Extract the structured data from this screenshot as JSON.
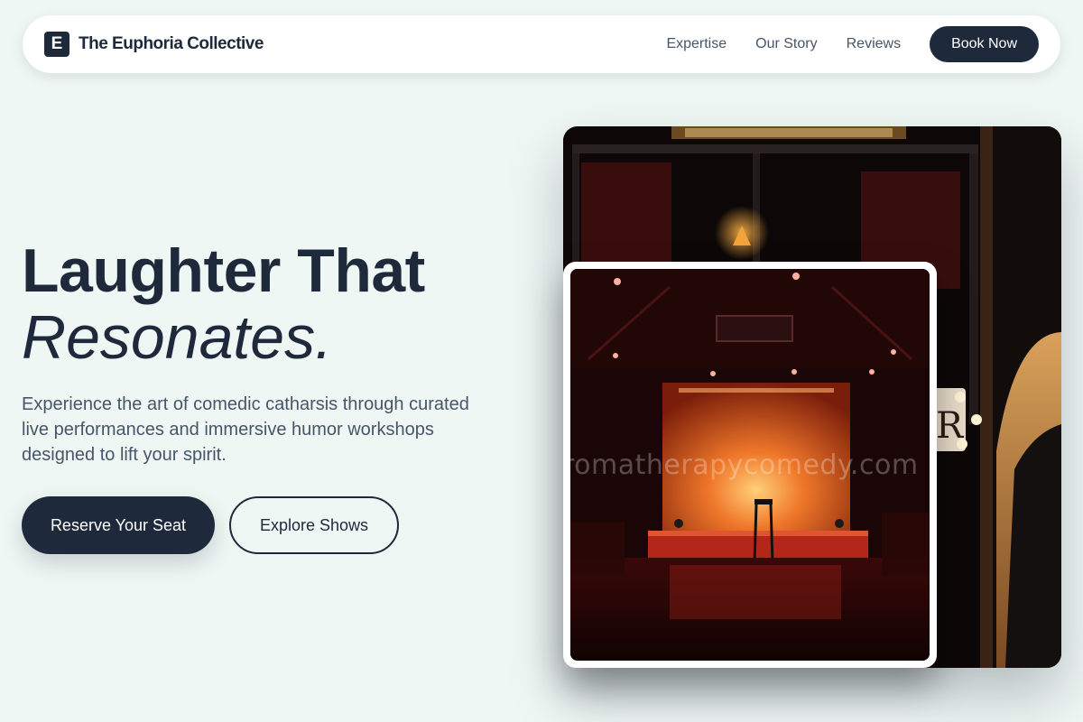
{
  "nav": {
    "logo_letter": "E",
    "brand": "The Euphoria Collective",
    "links": [
      "Expertise",
      "Our Story",
      "Reviews"
    ],
    "cta": "Book Now"
  },
  "hero": {
    "title_line1": "Laughter That",
    "title_line2": "Resonates.",
    "subtitle": "Experience the art of comedic catharsis through curated live performances and immersive humor workshops designed to lift your spirit.",
    "primary_cta": "Reserve Your Seat",
    "secondary_cta": "Explore Shows"
  },
  "photos": {
    "watermark": "romatherapycomedy.com"
  },
  "colors": {
    "background": "#eff7f4",
    "primary": "#1e293b",
    "muted_text": "#475569"
  }
}
